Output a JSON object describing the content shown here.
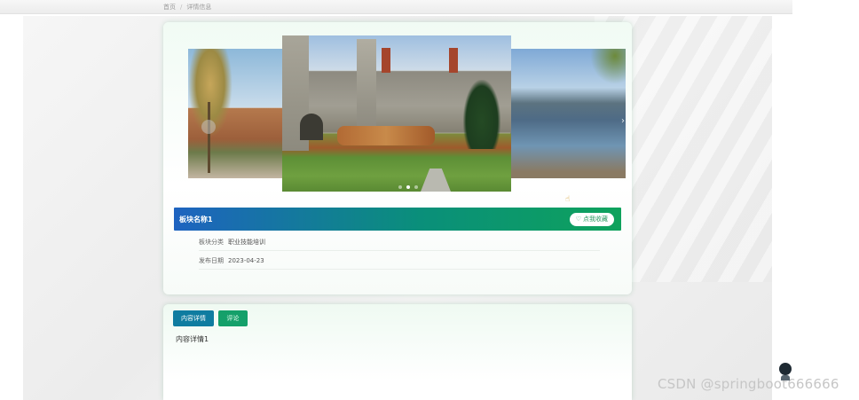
{
  "breadcrumb": {
    "home": "首页",
    "separator": "/",
    "current": "详情信息"
  },
  "carousel": {
    "slide_count": 3,
    "active_slide": 2
  },
  "detail": {
    "title": "板块名称1",
    "favorite_label": "点我收藏",
    "favorite_icon": "heart-icon",
    "fields": [
      {
        "label": "板块分类",
        "value": "职业技能培训"
      },
      {
        "label": "发布日期",
        "value": "2023-04-23"
      }
    ]
  },
  "tabs": [
    {
      "label": "内容详情"
    },
    {
      "label": "评论"
    }
  ],
  "content": {
    "text": "内容详情1"
  },
  "watermark": "CSDN @springboot666666",
  "colors": {
    "title_gradient_start": "#1e63c0",
    "title_gradient_end": "#0ea25c",
    "tab_active": "#0f7ca0",
    "tab_inactive": "#15a06a"
  }
}
